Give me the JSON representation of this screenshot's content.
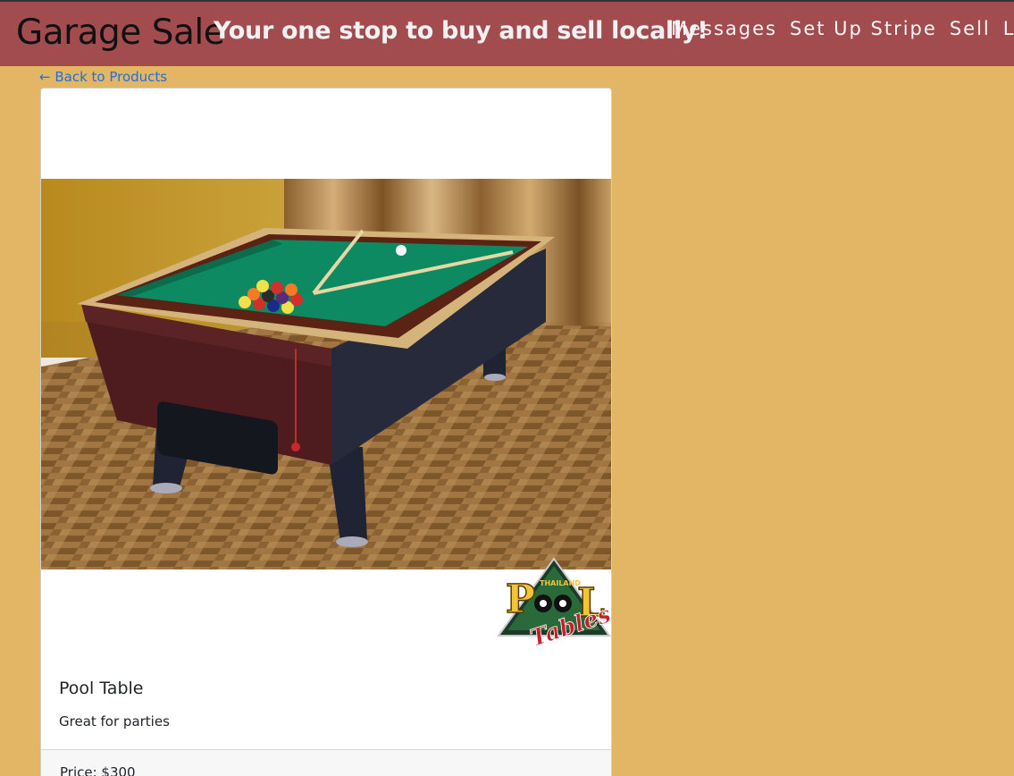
{
  "header": {
    "brand": "Garage Sale",
    "tagline": "Your one stop to buy and sell locally!",
    "nav": [
      {
        "label": "Messages"
      },
      {
        "label": "Set Up Stripe"
      },
      {
        "label": "Sell"
      },
      {
        "label": "Log"
      }
    ],
    "background": "#a34c50"
  },
  "back_link": "← Back to Products",
  "product": {
    "title": "Pool Table",
    "description": "Great for parties",
    "price": "Price: $300",
    "image": "pool-table-photo",
    "logo_text_small": "THAILAND",
    "logo_text_big": "POOL",
    "logo_text_script": "Tables"
  },
  "colors": {
    "page_bg": "#e3b665",
    "link": "#1f6fe0",
    "felt": "#0e8a62"
  }
}
